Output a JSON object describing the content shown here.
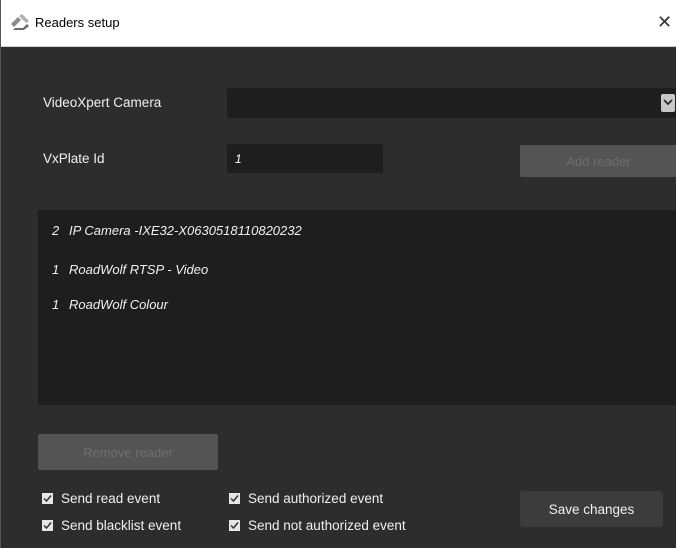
{
  "window": {
    "title": "Readers setup",
    "close_glyph": "✕",
    "icon": "readers-app-icon"
  },
  "form": {
    "camera_label": "VideoXpert Camera",
    "camera_value": "",
    "plate_label": "VxPlate Id",
    "plate_value": "1",
    "add_reader_label": "Add reader"
  },
  "readers": [
    {
      "count": "2",
      "name": "IP Camera -IXE32-X0630518110820232"
    },
    {
      "count": "1",
      "name": "RoadWolf RTSP - Video"
    },
    {
      "count": "1",
      "name": "RoadWolf Colour"
    }
  ],
  "remove_reader_label": "Remove reader",
  "options": {
    "send_read_event": {
      "label": "Send read event",
      "checked": true
    },
    "send_authorized_event": {
      "label": "Send authorized event",
      "checked": true
    },
    "send_blacklist_event": {
      "label": "Send blacklist event",
      "checked": true
    },
    "send_not_authorized_event": {
      "label": "Send not authorized event",
      "checked": true
    }
  },
  "save_label": "Save changes",
  "colors": {
    "background": "#2d2d30",
    "field_background": "#1e1e1e",
    "disabled_button": "#545454",
    "text": "#f0f0f0"
  }
}
